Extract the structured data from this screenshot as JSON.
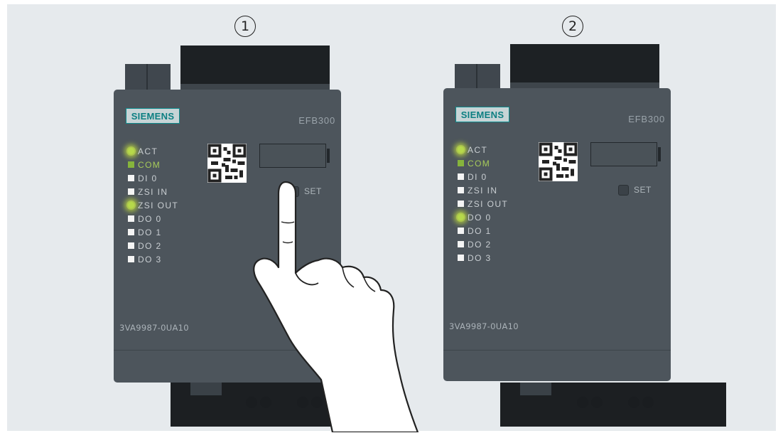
{
  "steps": [
    "1",
    "2"
  ],
  "devices": [
    {
      "brand": "SIEMENS",
      "model": "EFB300",
      "part_number": "3VA9987-0UA10",
      "set_label": "SET",
      "leds": [
        {
          "label": "ACT",
          "state": "blinking"
        },
        {
          "label": "COM",
          "state": "green"
        },
        {
          "label": "DI 0",
          "state": "off"
        },
        {
          "label": "ZSI IN",
          "state": "off"
        },
        {
          "label": "ZSI OUT",
          "state": "blinking"
        },
        {
          "label": "DO 0",
          "state": "off"
        },
        {
          "label": "DO 1",
          "state": "off"
        },
        {
          "label": "DO 2",
          "state": "off"
        },
        {
          "label": "DO 3",
          "state": "off"
        }
      ],
      "set_pressed": true
    },
    {
      "brand": "SIEMENS",
      "model": "EFB300",
      "part_number": "3VA9987-0UA10",
      "set_label": "SET",
      "leds": [
        {
          "label": "ACT",
          "state": "blinking"
        },
        {
          "label": "COM",
          "state": "green"
        },
        {
          "label": "DI 0",
          "state": "off"
        },
        {
          "label": "ZSI IN",
          "state": "off"
        },
        {
          "label": "ZSI OUT",
          "state": "off"
        },
        {
          "label": "DO 0",
          "state": "blinking"
        },
        {
          "label": "DO 1",
          "state": "off"
        },
        {
          "label": "DO 2",
          "state": "off"
        },
        {
          "label": "DO 3",
          "state": "off"
        }
      ],
      "set_pressed": false
    }
  ],
  "colors": {
    "background": "#e6eaed",
    "body": "#4d555c",
    "led_green": "#86b43c",
    "led_glow": "#b6d94a",
    "brand_teal": "#0c7f82"
  }
}
